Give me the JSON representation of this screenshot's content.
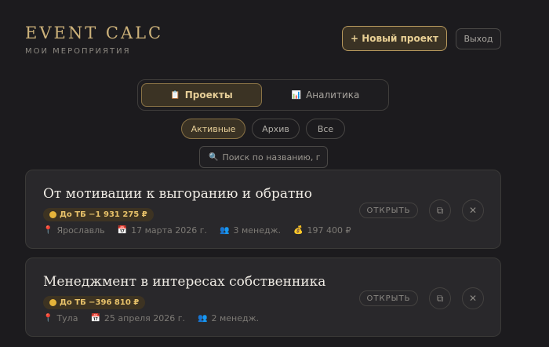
{
  "header": {
    "title": "EVENT CALC",
    "subtitle": "МОИ МЕРОПРИЯТИЯ",
    "new_project_label": "+ Новый проект",
    "logout_label": "Выход"
  },
  "tabs": [
    {
      "label": "Проекты",
      "icon": "clipboard-icon",
      "active": true
    },
    {
      "label": "Аналитика",
      "icon": "bar-chart-icon",
      "active": false
    }
  ],
  "filters": [
    {
      "label": "Активные",
      "active": true
    },
    {
      "label": "Архив",
      "active": false
    },
    {
      "label": "Все",
      "active": false
    }
  ],
  "search": {
    "placeholder": "Поиск по названию, гор",
    "value": ""
  },
  "projects": [
    {
      "title": "От мотивации к выгоранию и обратно",
      "badge": "До ТБ −1 931 275 ₽",
      "city": "Ярославль",
      "date": "17 марта 2026 г.",
      "managers": "3 менедж.",
      "budget": "197 400 ₽",
      "open_label": "ОТКРЫТЬ"
    },
    {
      "title": "Менеджмент в интересах собственника",
      "badge": "До ТБ −396 810 ₽",
      "city": "Тула",
      "date": "25 апреля 2026 г.",
      "managers": "2 менедж.",
      "open_label": "ОТКРЫТЬ"
    }
  ],
  "colors": {
    "accent": "#cdb27a",
    "background": "#1c1b1e",
    "card": "#29282b",
    "badge_text": "#e8c26a"
  }
}
